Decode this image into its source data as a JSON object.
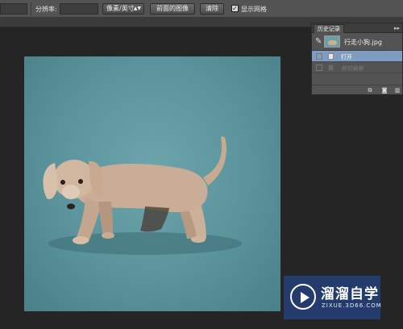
{
  "options_bar": {
    "resolution_label": "分辨率:",
    "unit_select": "像素/英寸",
    "front_image_button": "前面的图像",
    "clear_button": "清除",
    "show_grid_label": "显示网格",
    "show_grid_checked": true
  },
  "history_panel": {
    "tab_label": "历史记录",
    "snapshot_name": "行走小狗.jpg",
    "states": [
      {
        "label": "打开",
        "active": true
      },
      {
        "label": "剪切画板",
        "active": false
      }
    ]
  },
  "watermark": {
    "title": "溜溜自学",
    "url": "ZIXUE.3D66.COM"
  }
}
